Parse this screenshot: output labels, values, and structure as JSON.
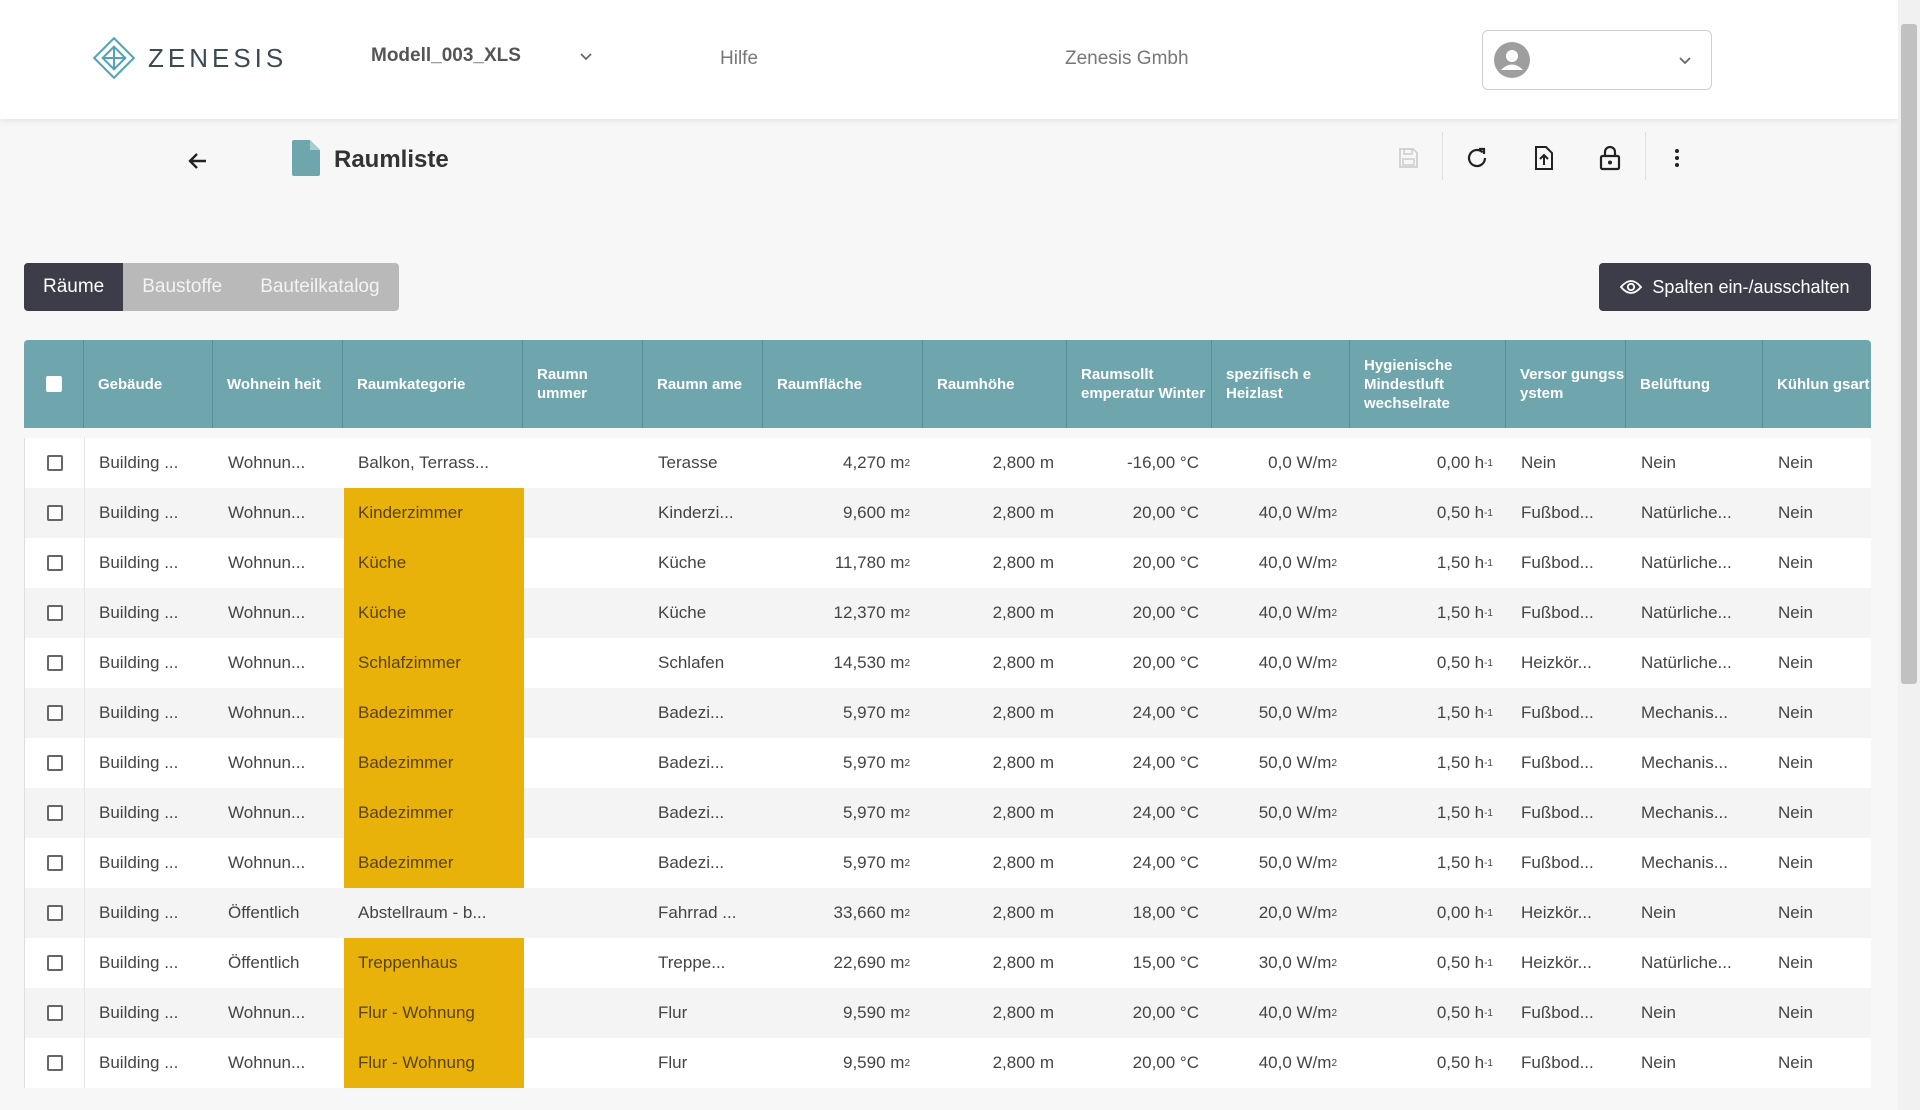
{
  "header": {
    "brand": "ZENESIS",
    "model": "Modell_003_XLS",
    "help": "Hilfe",
    "company": "Zenesis Gmbh"
  },
  "toolbar": {
    "title": "Raumliste"
  },
  "tabs": [
    {
      "label": "Räume",
      "active": true
    },
    {
      "label": "Baustoffe",
      "active": false
    },
    {
      "label": "Bauteilkatalog",
      "active": false
    }
  ],
  "columns_button": "Spalten ein-/ausschalten",
  "colors": {
    "header_teal": "#6fa6ad",
    "highlight": "#e8b20a",
    "dark": "#3d3d4a"
  },
  "table": {
    "columns": [
      "Gebäude",
      "Wohnein heit",
      "Raumkategorie",
      "Raumn ummer",
      "Raumn ame",
      "Raumfläche",
      "Raumhöhe",
      "Raumsollt emperatur Winter",
      "spezifisch e Heizlast",
      "Hygienische Mindestluft wechselrate",
      "Versor gungss ystem",
      "Belüftung",
      "Kühlun gsart"
    ],
    "rows": [
      {
        "building": "Building ...",
        "unit": "Wohnun...",
        "category": "Balkon, Terrass...",
        "highlight": false,
        "number": "",
        "name": "Terasse",
        "area": "4,270",
        "height": "2,800 m",
        "temp": "-16,00 °C",
        "load": "0,0 W/m",
        "air": "0,00 h",
        "supply": "Nein",
        "vent": "Nein",
        "cool": "Nein"
      },
      {
        "building": "Building ...",
        "unit": "Wohnun...",
        "category": "Kinderzimmer",
        "highlight": true,
        "number": "",
        "name": "Kinderzi...",
        "area": "9,600",
        "height": "2,800 m",
        "temp": "20,00 °C",
        "load": "40,0 W/m",
        "air": "0,50 h",
        "supply": "Fußbod...",
        "vent": "Natürliche...",
        "cool": "Nein"
      },
      {
        "building": "Building ...",
        "unit": "Wohnun...",
        "category": "Küche",
        "highlight": true,
        "number": "",
        "name": "Küche",
        "area": "11,780",
        "height": "2,800 m",
        "temp": "20,00 °C",
        "load": "40,0 W/m",
        "air": "1,50 h",
        "supply": "Fußbod...",
        "vent": "Natürliche...",
        "cool": "Nein"
      },
      {
        "building": "Building ...",
        "unit": "Wohnun...",
        "category": "Küche",
        "highlight": true,
        "number": "",
        "name": "Küche",
        "area": "12,370",
        "height": "2,800 m",
        "temp": "20,00 °C",
        "load": "40,0 W/m",
        "air": "1,50 h",
        "supply": "Fußbod...",
        "vent": "Natürliche...",
        "cool": "Nein"
      },
      {
        "building": "Building ...",
        "unit": "Wohnun...",
        "category": "Schlafzimmer",
        "highlight": true,
        "number": "",
        "name": "Schlafen",
        "area": "14,530",
        "height": "2,800 m",
        "temp": "20,00 °C",
        "load": "40,0 W/m",
        "air": "0,50 h",
        "supply": "Heizkör...",
        "vent": "Natürliche...",
        "cool": "Nein"
      },
      {
        "building": "Building ...",
        "unit": "Wohnun...",
        "category": "Badezimmer",
        "highlight": true,
        "number": "",
        "name": "Badezi...",
        "area": "5,970",
        "height": "2,800 m",
        "temp": "24,00 °C",
        "load": "50,0 W/m",
        "air": "1,50 h",
        "supply": "Fußbod...",
        "vent": "Mechanis...",
        "cool": "Nein"
      },
      {
        "building": "Building ...",
        "unit": "Wohnun...",
        "category": "Badezimmer",
        "highlight": true,
        "number": "",
        "name": "Badezi...",
        "area": "5,970",
        "height": "2,800 m",
        "temp": "24,00 °C",
        "load": "50,0 W/m",
        "air": "1,50 h",
        "supply": "Fußbod...",
        "vent": "Mechanis...",
        "cool": "Nein"
      },
      {
        "building": "Building ...",
        "unit": "Wohnun...",
        "category": "Badezimmer",
        "highlight": true,
        "number": "",
        "name": "Badezi...",
        "area": "5,970",
        "height": "2,800 m",
        "temp": "24,00 °C",
        "load": "50,0 W/m",
        "air": "1,50 h",
        "supply": "Fußbod...",
        "vent": "Mechanis...",
        "cool": "Nein"
      },
      {
        "building": "Building ...",
        "unit": "Wohnun...",
        "category": "Badezimmer",
        "highlight": true,
        "number": "",
        "name": "Badezi...",
        "area": "5,970",
        "height": "2,800 m",
        "temp": "24,00 °C",
        "load": "50,0 W/m",
        "air": "1,50 h",
        "supply": "Fußbod...",
        "vent": "Mechanis...",
        "cool": "Nein"
      },
      {
        "building": "Building ...",
        "unit": "Öffentlich",
        "category": "Abstellraum - b...",
        "highlight": false,
        "number": "",
        "name": "Fahrrad ...",
        "area": "33,660",
        "height": "2,800 m",
        "temp": "18,00 °C",
        "load": "20,0 W/m",
        "air": "0,00 h",
        "supply": "Heizkör...",
        "vent": "Nein",
        "cool": "Nein"
      },
      {
        "building": "Building ...",
        "unit": "Öffentlich",
        "category": "Treppenhaus",
        "highlight": true,
        "number": "",
        "name": "Treppe...",
        "area": "22,690",
        "height": "2,800 m",
        "temp": "15,00 °C",
        "load": "30,0 W/m",
        "air": "0,50 h",
        "supply": "Heizkör...",
        "vent": "Natürliche...",
        "cool": "Nein"
      },
      {
        "building": "Building ...",
        "unit": "Wohnun...",
        "category": "Flur - Wohnung",
        "highlight": true,
        "number": "",
        "name": "Flur",
        "area": "9,590",
        "height": "2,800 m",
        "temp": "20,00 °C",
        "load": "40,0 W/m",
        "air": "0,50 h",
        "supply": "Fußbod...",
        "vent": "Nein",
        "cool": "Nein"
      },
      {
        "building": "Building ...",
        "unit": "Wohnun...",
        "category": "Flur - Wohnung",
        "highlight": true,
        "number": "",
        "name": "Flur",
        "area": "9,590",
        "height": "2,800 m",
        "temp": "20,00 °C",
        "load": "40,0 W/m",
        "air": "0,50 h",
        "supply": "Fußbod...",
        "vent": "Nein",
        "cool": "Nein"
      }
    ]
  }
}
